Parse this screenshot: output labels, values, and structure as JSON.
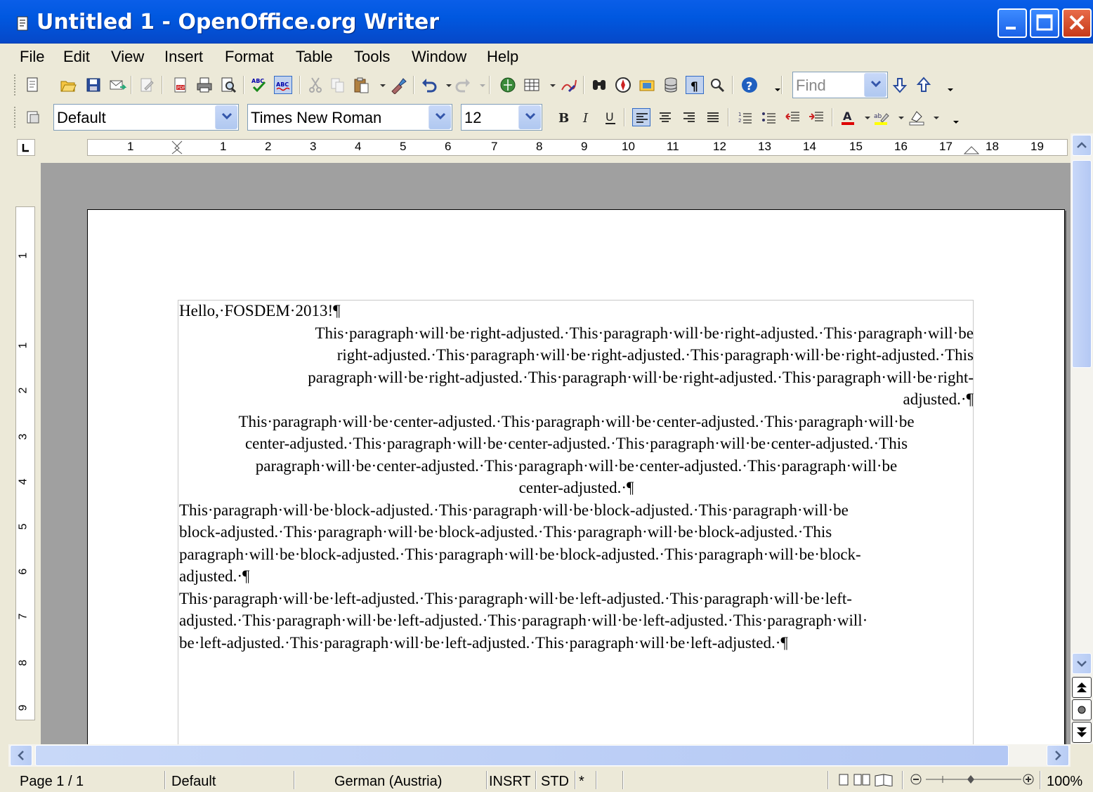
{
  "window": {
    "title": "Untitled 1 - OpenOffice.org Writer"
  },
  "menu": {
    "items": [
      "File",
      "Edit",
      "View",
      "Insert",
      "Format",
      "Table",
      "Tools",
      "Window",
      "Help"
    ]
  },
  "formatting": {
    "style": "Default",
    "font": "Times New Roman",
    "size": "12"
  },
  "find": {
    "placeholder": "Find"
  },
  "ruler": {
    "labels": [
      "1",
      "1",
      "2",
      "3",
      "4",
      "5",
      "6",
      "7",
      "8",
      "9",
      "10",
      "11",
      "12",
      "13",
      "14",
      "15",
      "16",
      "17",
      "18",
      "19"
    ]
  },
  "vruler": {
    "labels": [
      "1",
      "1",
      "2",
      "3",
      "4",
      "5",
      "6",
      "7",
      "8",
      "9"
    ]
  },
  "document": {
    "heading": "Hello,·FOSDEM·2013!¶",
    "right": [
      "This·paragraph·will·be·right-adjusted.·This·paragraph·will·be·right-adjusted.·This·paragraph·will·be",
      "right-adjusted.·This·paragraph·will·be·right-adjusted.·This·paragraph·will·be·right-adjusted.·This",
      "paragraph·will·be·right-adjusted.·This·paragraph·will·be·right-adjusted.·This·paragraph·will·be·right-",
      "adjusted.·¶"
    ],
    "center": [
      "This·paragraph·will·be·center-adjusted.·This·paragraph·will·be·center-adjusted.·This·paragraph·will·be",
      "center-adjusted.·This·paragraph·will·be·center-adjusted.·This·paragraph·will·be·center-adjusted.·This",
      "paragraph·will·be·center-adjusted.·This·paragraph·will·be·center-adjusted.·This·paragraph·will·be",
      "center-adjusted.·¶"
    ],
    "block": [
      "This·paragraph·will·be·block-adjusted.·This·paragraph·will·be·block-adjusted.·This·paragraph·will·be",
      "block-adjusted.·This·paragraph·will·be·block-adjusted.·This·paragraph·will·be·block-adjusted.·This",
      "paragraph·will·be·block-adjusted.·This·paragraph·will·be·block-adjusted.·This·paragraph·will·be·block-",
      "adjusted.·¶"
    ],
    "left": [
      "This·paragraph·will·be·left-adjusted.·This·paragraph·will·be·left-adjusted.·This·paragraph·will·be·left-",
      "adjusted.·This·paragraph·will·be·left-adjusted.·This·paragraph·will·be·left-adjusted.·This·paragraph·will·",
      "be·left-adjusted.·This·paragraph·will·be·left-adjusted.·This·paragraph·will·be·left-adjusted.·¶"
    ]
  },
  "status": {
    "page": "Page 1 / 1",
    "style": "Default",
    "language": "German (Austria)",
    "insert": "INSRT",
    "selection": "STD",
    "modified": "*",
    "zoom": "100%"
  },
  "colors": {
    "titlebar": "#0058e0",
    "chrome": "#ece9d8",
    "workspace": "#a0a0a0"
  }
}
